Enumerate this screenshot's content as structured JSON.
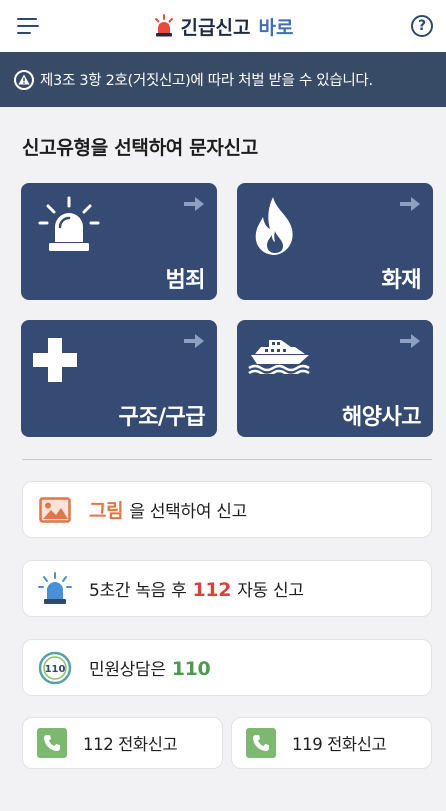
{
  "header": {
    "title_main": "긴급신고",
    "title_accent": "바로",
    "menu_icon": "hamburger-menu-icon",
    "help_label": "?"
  },
  "warning": {
    "text": "제3조 3항 2호(거짓신고)에 따라 처벌 받을 수 있습니다."
  },
  "section_title": "신고유형을 선택하여 문자신고",
  "report_types": [
    {
      "label": "범죄",
      "icon": "siren-icon"
    },
    {
      "label": "화재",
      "icon": "fire-icon"
    },
    {
      "label": "구조/구급",
      "icon": "medical-cross-icon"
    },
    {
      "label": "해양사고",
      "icon": "ship-icon"
    }
  ],
  "options": {
    "image": {
      "highlight": "그림",
      "rest": "을 선택하여 신고"
    },
    "record": {
      "prefix": "5초간 녹음 후",
      "number": "112",
      "suffix": "자동 신고"
    },
    "civil": {
      "prefix": "민원상담은",
      "number": "110",
      "badge": "110"
    }
  },
  "calls": [
    {
      "label": "112 전화신고"
    },
    {
      "label": "119 전화신고"
    }
  ],
  "colors": {
    "tile": "#364b73",
    "warning_bar": "#374a66",
    "accent_blue": "#3f6fb5",
    "orange": "#e0764a",
    "red": "#d9433f",
    "green": "#4f9a51",
    "phone_green": "#7cb86f"
  }
}
